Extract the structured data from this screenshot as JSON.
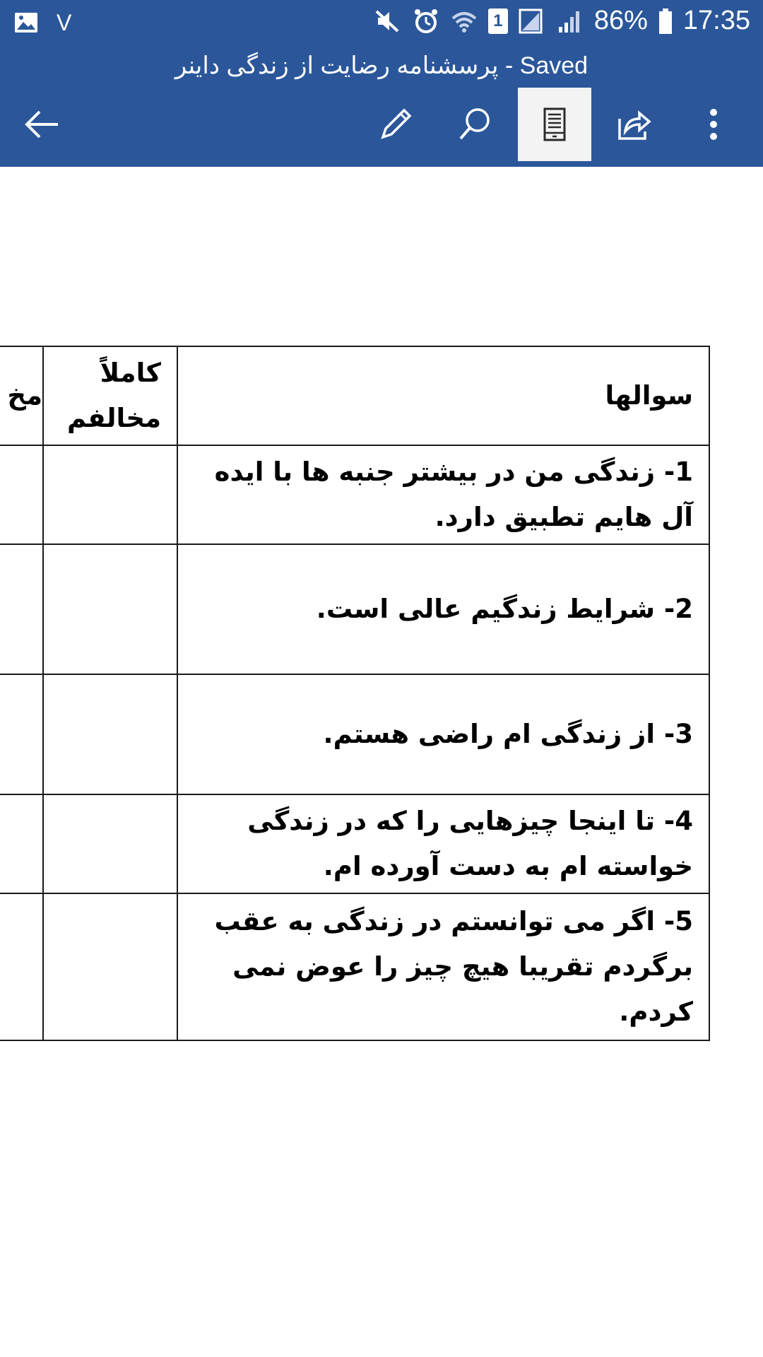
{
  "status_bar": {
    "left_icons": [
      "gallery-icon",
      "v-notification-icon"
    ],
    "v_label": "V",
    "battery": "86%",
    "time": "17:35",
    "sim_badge": "1",
    "right_icons": [
      "mute-icon",
      "alarm-icon",
      "wifi-icon",
      "sim-icon",
      "signal-icon",
      "battery-icon"
    ]
  },
  "title_bar": {
    "title": "پرسشنامه رضایت از زندگی داینر - Saved"
  },
  "toolbar": {
    "buttons": [
      "back-icon",
      "pencil-icon",
      "search-icon",
      "mobile-view-icon",
      "share-icon",
      "more-icon"
    ],
    "active": "mobile-view-icon"
  },
  "table": {
    "header": {
      "questions": "سوالها",
      "col1": "کاملاً مخالفم",
      "col2_partial": "مخ"
    },
    "rows": [
      {
        "text": "1- زندگی من در بیشتر جنبه ها با ایده آل هایم تطبیق دارد."
      },
      {
        "text": "2- شرایط زندگیم عالی است."
      },
      {
        "text": "3- از زندگی ام راضی هستم."
      },
      {
        "text": "4- تا اینجا چیزهایی را که در زندگی خواسته ام به دست آورده ام."
      },
      {
        "text": "5- اگر می توانستم در زندگی به عقب برگردم تقریبا هیچ چیز را عوض نمی کردم."
      }
    ]
  },
  "colors": {
    "brand": "#2b579a",
    "toolbar_active": "#f3f3f3",
    "page": "#ffffff",
    "border": "#1a1a1a"
  }
}
